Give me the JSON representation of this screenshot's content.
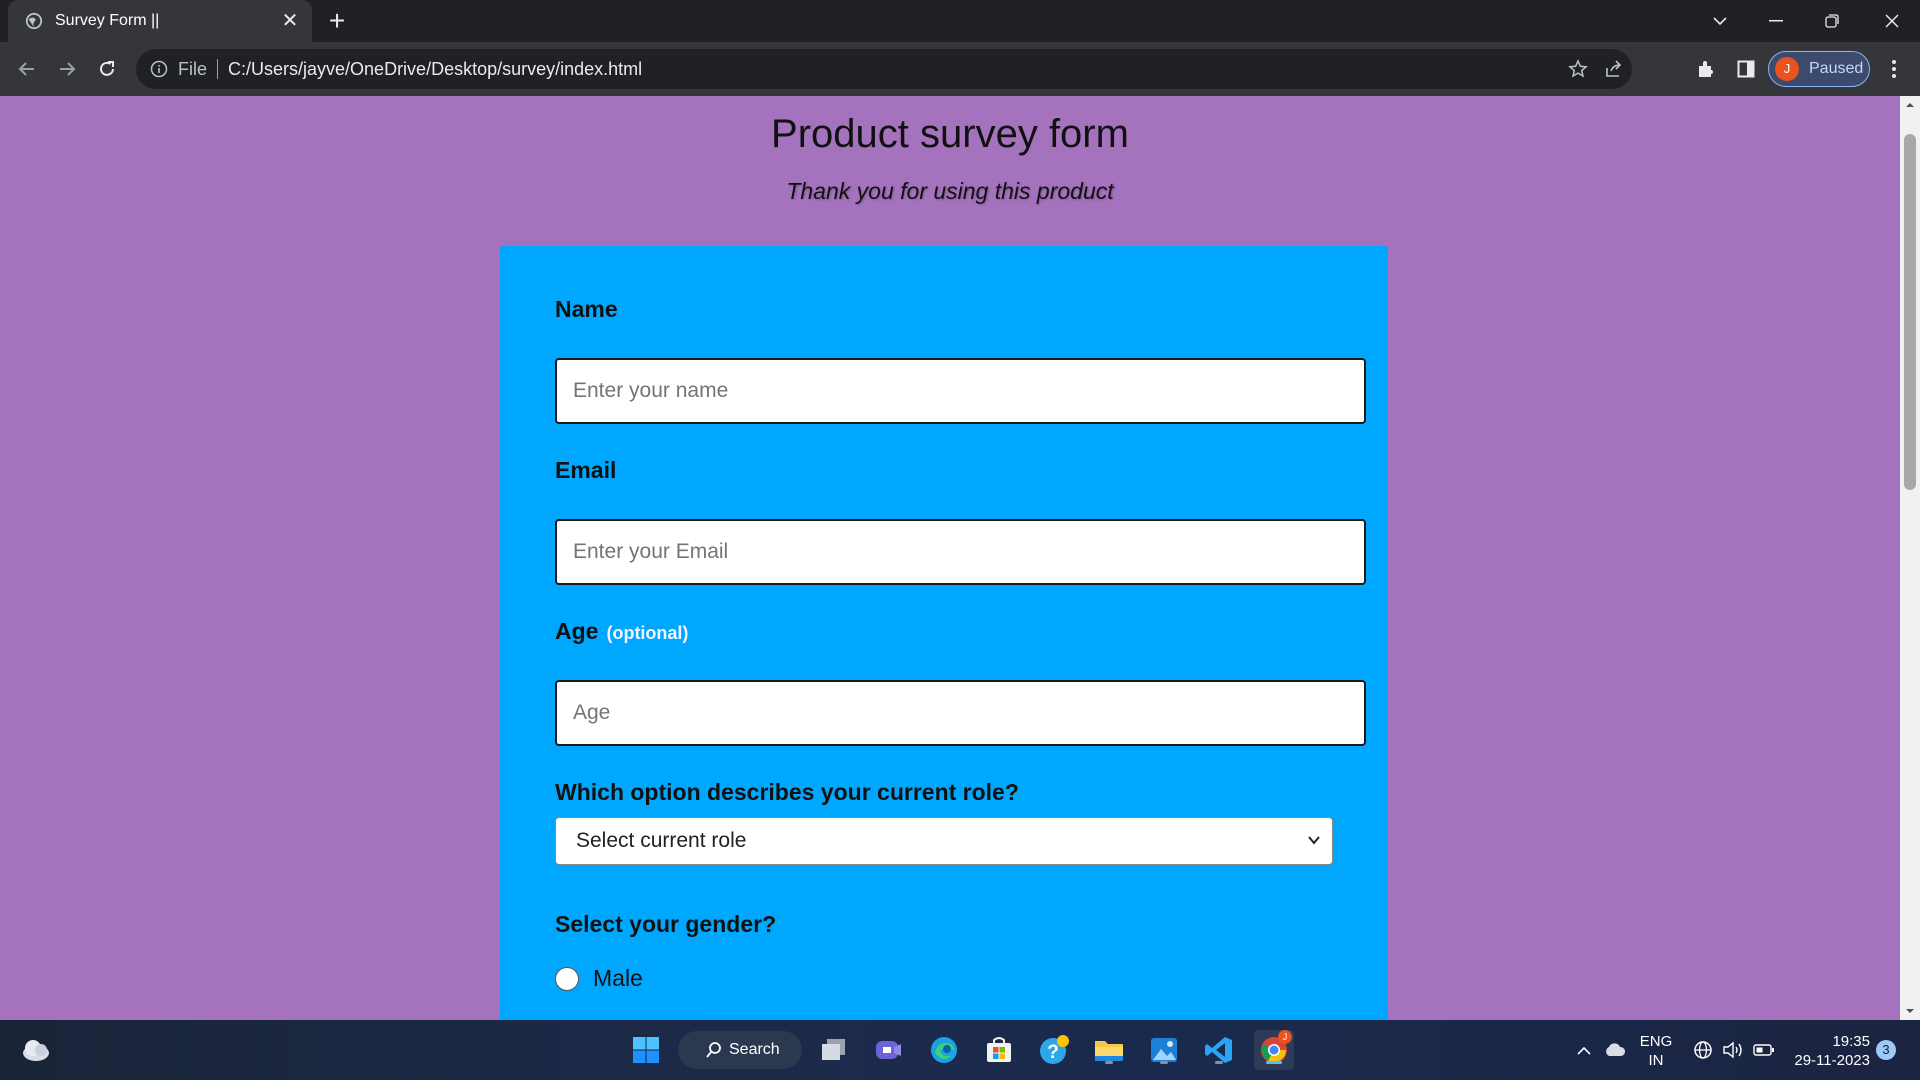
{
  "browser": {
    "tab_title": "Survey Form ||",
    "address_scheme": "File",
    "address_url": "C:/Users/jayve/OneDrive/Desktop/survey/index.html",
    "profile_initial": "J",
    "profile_status": "Paused"
  },
  "page": {
    "title": "Product survey form",
    "subtitle": "Thank you for using this product",
    "background_color": "#a573be",
    "card_color": "#00a7ff"
  },
  "form": {
    "name_label": "Name",
    "name_placeholder": "Enter your name",
    "email_label": "Email",
    "email_placeholder": "Enter your Email",
    "age_label": "Age",
    "age_optional": "(optional)",
    "age_placeholder": "Age",
    "role_label": "Which option describes your current role?",
    "role_selected": "Select current role",
    "gender_label": "Select your gender?",
    "gender_options": [
      "Male"
    ]
  },
  "taskbar": {
    "search_label": "Search",
    "lang_line1": "ENG",
    "lang_line2": "IN",
    "time": "19:35",
    "date": "29-11-2023",
    "notification_count": "3",
    "chrome_badge": "J"
  }
}
